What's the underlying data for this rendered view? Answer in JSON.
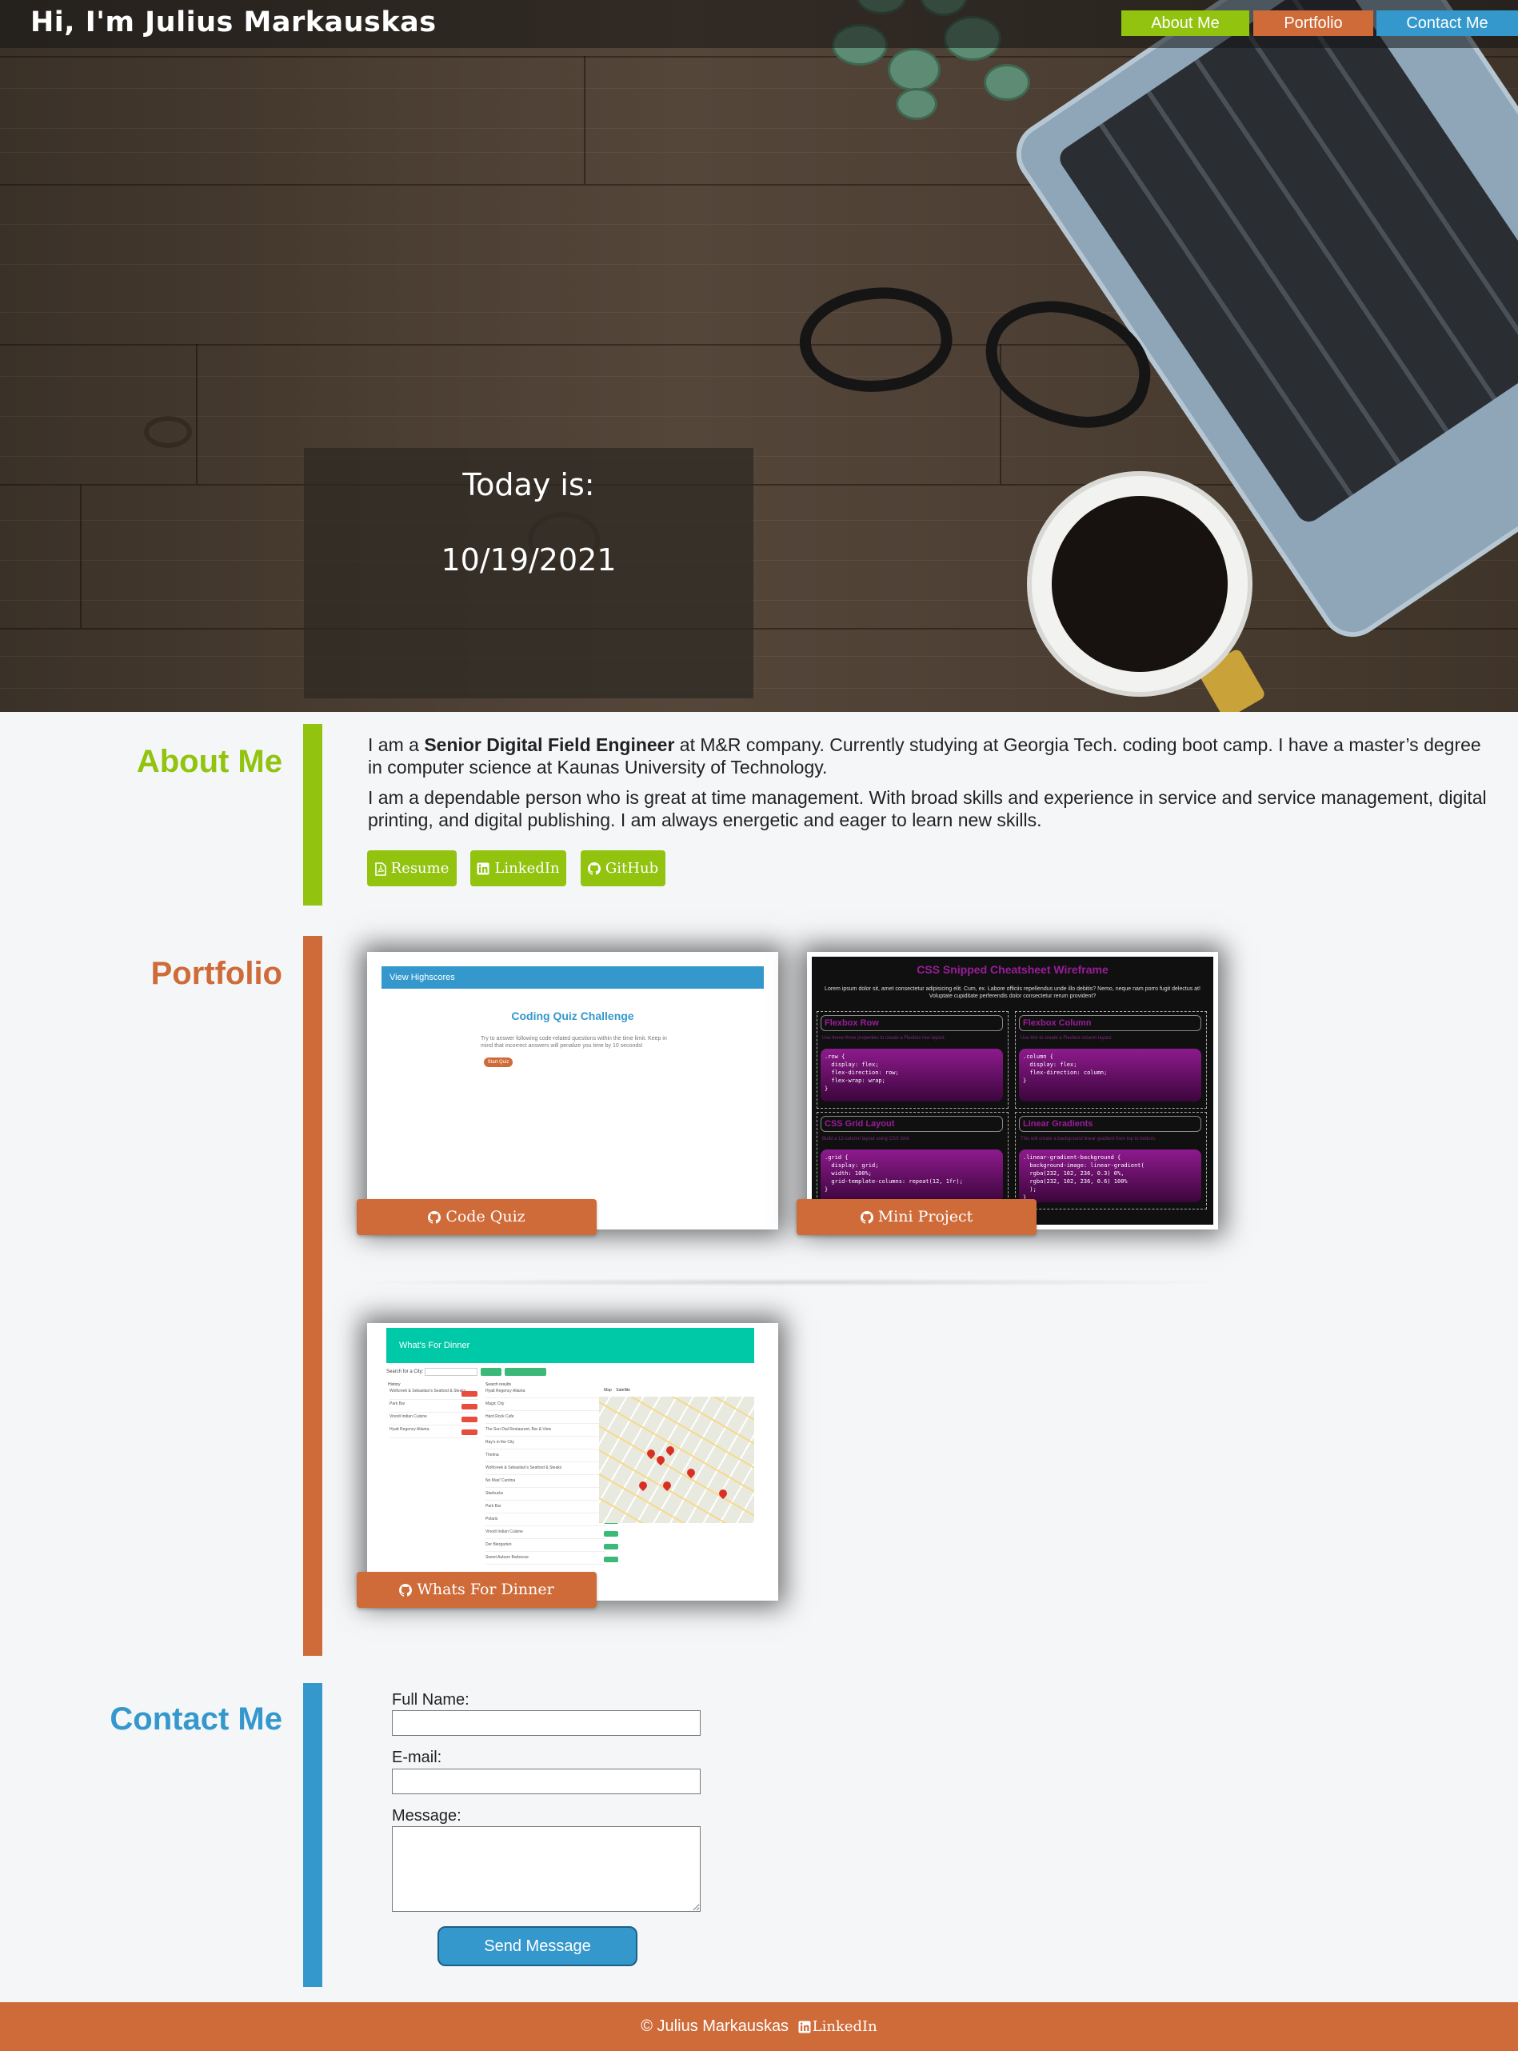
{
  "header": {
    "title": "Hi, I'm Julius Markauskas",
    "nav": [
      {
        "label": "About Me"
      },
      {
        "label": "Portfolio"
      },
      {
        "label": "Contact Me"
      }
    ]
  },
  "hero": {
    "today_label": "Today is:",
    "date": "10/19/2021"
  },
  "about": {
    "title": "About Me",
    "p1_pre": "I am a ",
    "p1_bold": "Senior Digital Field Engineer",
    "p1_post": " at M&R company. Currently studying at Georgia Tech. coding boot camp. I have a master’s degree in computer science at Kaunas University of Technology.",
    "p2": "I am a dependable person who is great at time management. With broad skills and experience in service and service management, digital printing, and digital publishing. I am always energetic and eager to learn new skills.",
    "buttons": [
      {
        "label": "Resume",
        "icon": "file-pdf-icon"
      },
      {
        "label": "LinkedIn",
        "icon": "linkedin-icon"
      },
      {
        "label": "GitHub",
        "icon": "github-icon"
      }
    ]
  },
  "portfolio": {
    "title": "Portfolio",
    "projects": [
      {
        "label": "Code Quiz",
        "icon": "github-icon",
        "preview": {
          "bar": "View Highscores",
          "heading": "Coding Quiz Challenge",
          "text": "Try to answer following code-related questions within the time limit. Keep in mind that incorrect answers will penalize you time by 10 seconds!",
          "button": "Start Quiz"
        }
      },
      {
        "label": "Mini Project",
        "icon": "github-icon",
        "preview": {
          "heading": "CSS Snipped Cheatsheet Wireframe",
          "intro": "Lorem ipsum dolor sit, amet consectetur adipisicing elit. Cum, ex. Labore officiis repellendus unde illo debitis? Nemo, neque nam porro fugit delectus at! Voluptate cupiditate perferendis dolor consectetur rerum provident?",
          "boxes": [
            {
              "title": "Flexbox Row",
              "desc": "Use these three properties to create a Flexbox row layout.",
              "code": ".row {\n  display: flex;\n  flex-direction: row;\n  flex-wrap: wrap;\n}"
            },
            {
              "title": "Flexbox Column",
              "desc": "Use this to create a Flexbox column layout.",
              "code": ".column {\n  display: flex;\n  flex-direction: column;\n}"
            },
            {
              "title": "CSS Grid Layout",
              "desc": "Build a 12-column layout using CSS Grid",
              "code": ".grid {\n  display: grid;\n  width: 100%;\n  grid-template-columns: repeat(12, 1fr);\n}"
            },
            {
              "title": "Linear Gradients",
              "desc": "This will create a background linear gradient from top to bottom.",
              "code": ".linear-gradient-background {\n  background-image: linear-gradient(\n  rgba(232, 102, 236, 0.3) 0%,\n  rgba(232, 102, 236, 0.6) 100%\n  );\n}"
            }
          ]
        }
      },
      {
        "label": "Whats For Dinner",
        "icon": "github-icon",
        "preview": {
          "bar": "What's For Dinner",
          "search_label": "Search for a City:",
          "history_label": "History",
          "results_label": "Search results",
          "history": [
            "Wolfcreek & Sebastian's Seafood & Steaks",
            "Park Bar",
            "Vinodi Indian Cuisine",
            "Hyatt Regency Atlanta"
          ],
          "results": [
            "Hyatt Regency Atlanta",
            "Magic City",
            "Hard Rock Cafe",
            "The Sun Dial Restaurant, Bar & View",
            "Ray's in the City",
            "Thelma",
            "Wolfcreek & Sebastian's Seafood & Steaks",
            "No Mas! Cantina",
            "Starbucks",
            "Park Bar",
            "Polaris",
            "Vinodi Indian Cuisine",
            "Der Biergarten",
            "Sweet Auburn Barbecue"
          ],
          "map_tabs": [
            "Map",
            "Satellite"
          ]
        }
      }
    ]
  },
  "contact": {
    "title": "Contact Me",
    "fields": [
      {
        "label": "Full Name:",
        "value": ""
      },
      {
        "label": "E-mail:",
        "value": ""
      },
      {
        "label": "Message:",
        "value": ""
      }
    ],
    "submit": "Send Message"
  },
  "footer": {
    "copyright": "© Julius Markauskas",
    "link": "LinkedIn",
    "link_icon": "linkedin-icon"
  },
  "colors": {
    "green": "#91c30f",
    "orange": "#cf6b39",
    "blue": "#3498cd"
  }
}
